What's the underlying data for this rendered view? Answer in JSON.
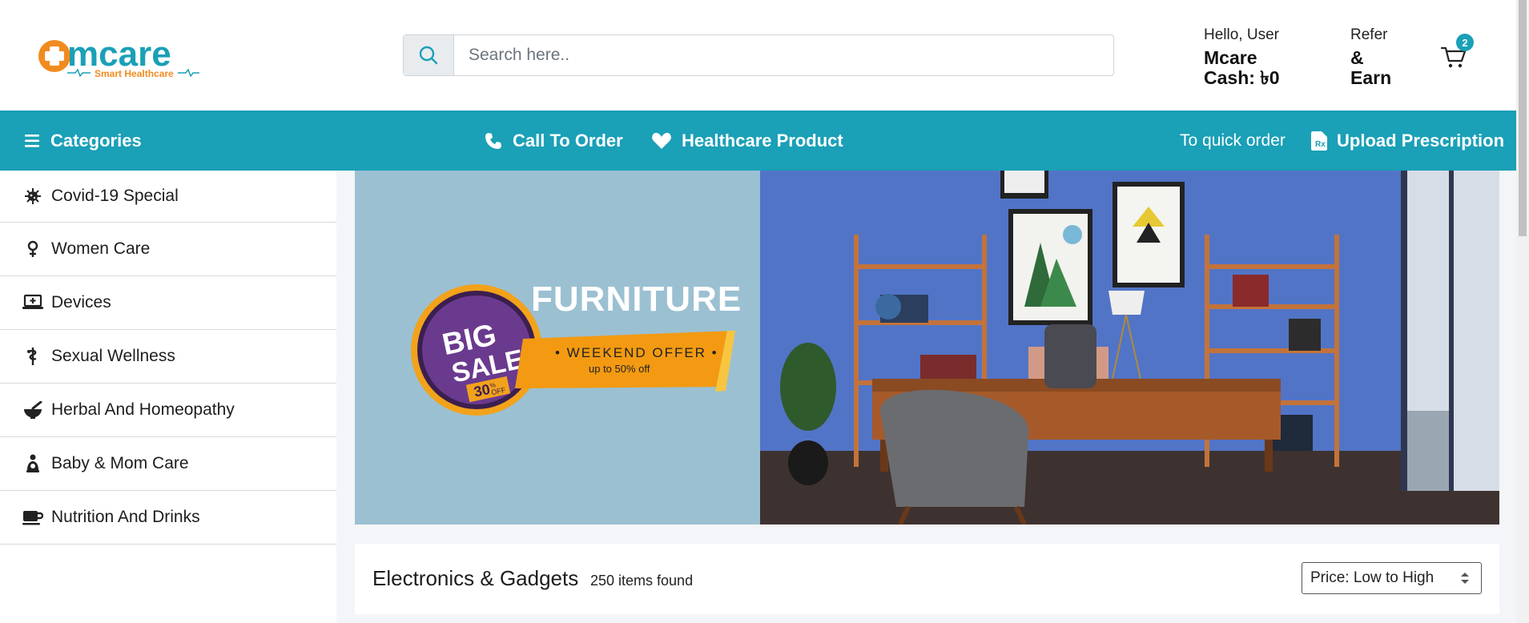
{
  "logo": {
    "brand": "mcare",
    "tagline": "Smart Healthcare"
  },
  "search": {
    "placeholder": "Search here.."
  },
  "account": {
    "greeting": "Hello, User",
    "cash": "Mcare Cash: ৳0"
  },
  "refer": {
    "top": "Refer",
    "bottom": "& Earn"
  },
  "cart": {
    "count": "2"
  },
  "nav": {
    "categories": "Categories",
    "call": "Call To Order",
    "healthcare": "Healthcare Product",
    "quick_order": "To quick order",
    "upload": "Upload Prescription"
  },
  "sidebar": {
    "items": [
      {
        "label": "Covid-19 Special",
        "icon": "virus-icon"
      },
      {
        "label": "Women Care",
        "icon": "female-icon"
      },
      {
        "label": "Devices",
        "icon": "laptop-medical-icon"
      },
      {
        "label": "Sexual Wellness",
        "icon": "staff-snake-icon"
      },
      {
        "label": "Herbal And Homeopathy",
        "icon": "mortar-pestle-icon"
      },
      {
        "label": "Baby & Mom Care",
        "icon": "baby-carriage-icon"
      },
      {
        "label": "Nutrition And Drinks",
        "icon": "mug-icon"
      }
    ]
  },
  "banner": {
    "title": "FURNITURE",
    "badge_line1": "BIG",
    "badge_line2": "SALE",
    "badge_pct": "30",
    "badge_pct_sign": "%",
    "badge_off": "OFF",
    "offer": "• WEEKEND OFFER •",
    "offer_sub": "up to 50% off"
  },
  "products": {
    "title": "Electronics & Gadgets",
    "count": "250 items found",
    "sort_value": "Price: Low to High"
  },
  "colors": {
    "accent": "#1aa0b7",
    "brand_orange": "#f28b1e"
  }
}
